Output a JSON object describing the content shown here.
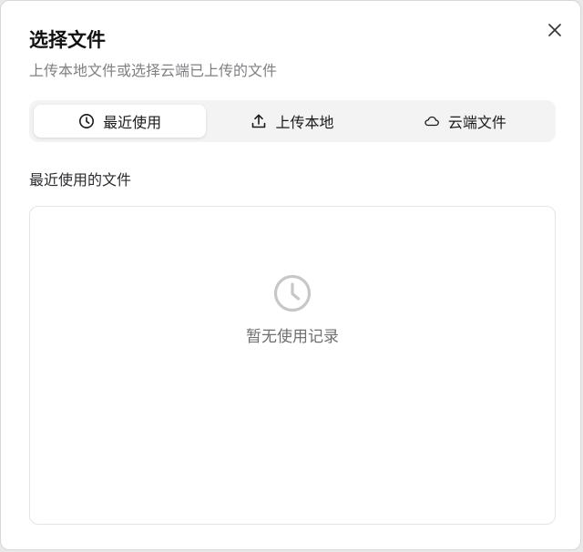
{
  "dialog": {
    "title": "选择文件",
    "subtitle": "上传本地文件或选择云端已上传的文件",
    "close_icon": "close-icon"
  },
  "tabs": [
    {
      "label": "最近使用",
      "icon": "clock-icon",
      "active": true
    },
    {
      "label": "上传本地",
      "icon": "upload-icon",
      "active": false
    },
    {
      "label": "云端文件",
      "icon": "cloud-icon",
      "active": false
    }
  ],
  "recent": {
    "section_label": "最近使用的文件",
    "empty_icon": "clock-icon",
    "empty_text": "暂无使用记录"
  },
  "colors": {
    "text_primary": "#111111",
    "text_secondary": "#808085",
    "tab_bar_bg": "#f3f3f4",
    "active_tab_bg": "#ffffff",
    "empty_icon": "#c7c7ca"
  }
}
